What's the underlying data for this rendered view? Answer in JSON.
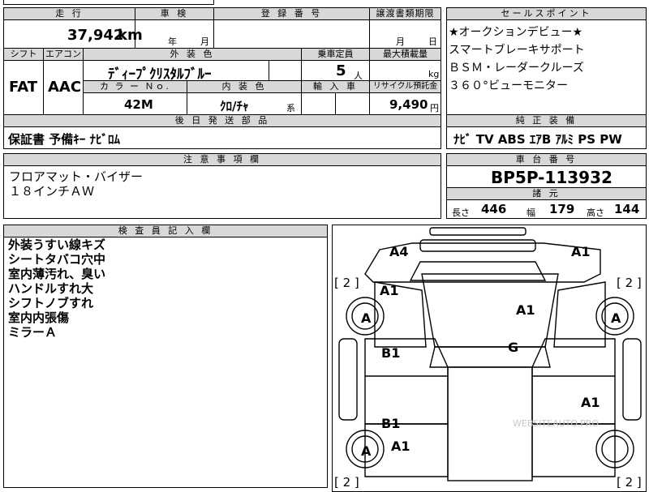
{
  "top_strip": {
    "partial_text": "■■■■"
  },
  "headers": {
    "mileage": "走 行",
    "inspection": "車 検",
    "registration": "登 録 番 号",
    "transfer_deadline": "譲渡書類期限",
    "sales_point": "セールスポイント",
    "shift": "シフト",
    "aircon": "エアコン",
    "exterior_color": "外 装 色",
    "capacity": "乗車定員",
    "max_load": "最大積載量",
    "color_no": "カ ラ ー Ｎｏ.",
    "interior_color": "内 装 色",
    "import": "輸 入 車",
    "recycle": "リサイクル預託金",
    "post_parts": "後 日 発 送 部 品",
    "standard_equipment": "純 正 装 備",
    "notes": "注 意 事 項 欄",
    "chassis_no": "車 台 番 号",
    "specs": "諸 元",
    "inspector_notes": "検 査 員 記 入 欄"
  },
  "values": {
    "mileage": "37,942",
    "mileage_unit": "km",
    "inspection_year": "年",
    "inspection_month": "月",
    "transfer_month": "月",
    "transfer_day": "日",
    "shift": "FAT",
    "aircon": "AAC",
    "exterior_color": "ﾃﾞｨｰﾌﾟｸﾘｽﾀﾙﾌﾞﾙｰ",
    "capacity": "5",
    "capacity_unit": "人",
    "max_load_unit": "kg",
    "color_no": "42M",
    "interior_color": "ｸﾛ/ﾁｬ",
    "interior_suffix": "系",
    "recycle": "9,490",
    "recycle_unit": "円",
    "post_parts": "保証書 予備ｷｰ ﾅﾋﾞﾛﾑ",
    "standard_equipment": "ﾅﾋﾞ  TV  ABS  ｴｱB  ｱﾙﾐ  PS  PW",
    "chassis_no": "BP5P-113932",
    "length_label": "長さ",
    "length": "446",
    "width_label": "幅",
    "width": "179",
    "height_label": "高さ",
    "height": "144"
  },
  "sales_points": [
    "★オークションデビュー★",
    "スマートブレーキサポート",
    "ＢＳＭ・レーダークルーズ",
    "３６０°ビューモニター"
  ],
  "notes": [
    "フロアマット・バイザー",
    "１８インチＡＷ"
  ],
  "inspector_notes": [
    "外装うすい線キズ",
    "シートタバコ穴中",
    "室内薄汚れ、臭い",
    "ハンドルすれ大",
    "シフトノブすれ",
    "室内内張傷",
    "ミラーＡ"
  ],
  "diagram": {
    "marks": {
      "front_left": "A4",
      "front_right": "A1",
      "fender_left": "A1",
      "hood": "A1",
      "tire_fl": "A",
      "tire_fr": "A",
      "door_fl": "B1",
      "roof": "G",
      "door_rr": "A1",
      "door_rl": "B1",
      "tire_rl_mark": "A1",
      "tire_rl": "A"
    },
    "tire_brackets": [
      "[ 2 ]",
      "[ 2 ]",
      "[ 2 ]",
      "[ 2 ]"
    ],
    "watermark": "WEBSITEAUTO.PRO"
  }
}
